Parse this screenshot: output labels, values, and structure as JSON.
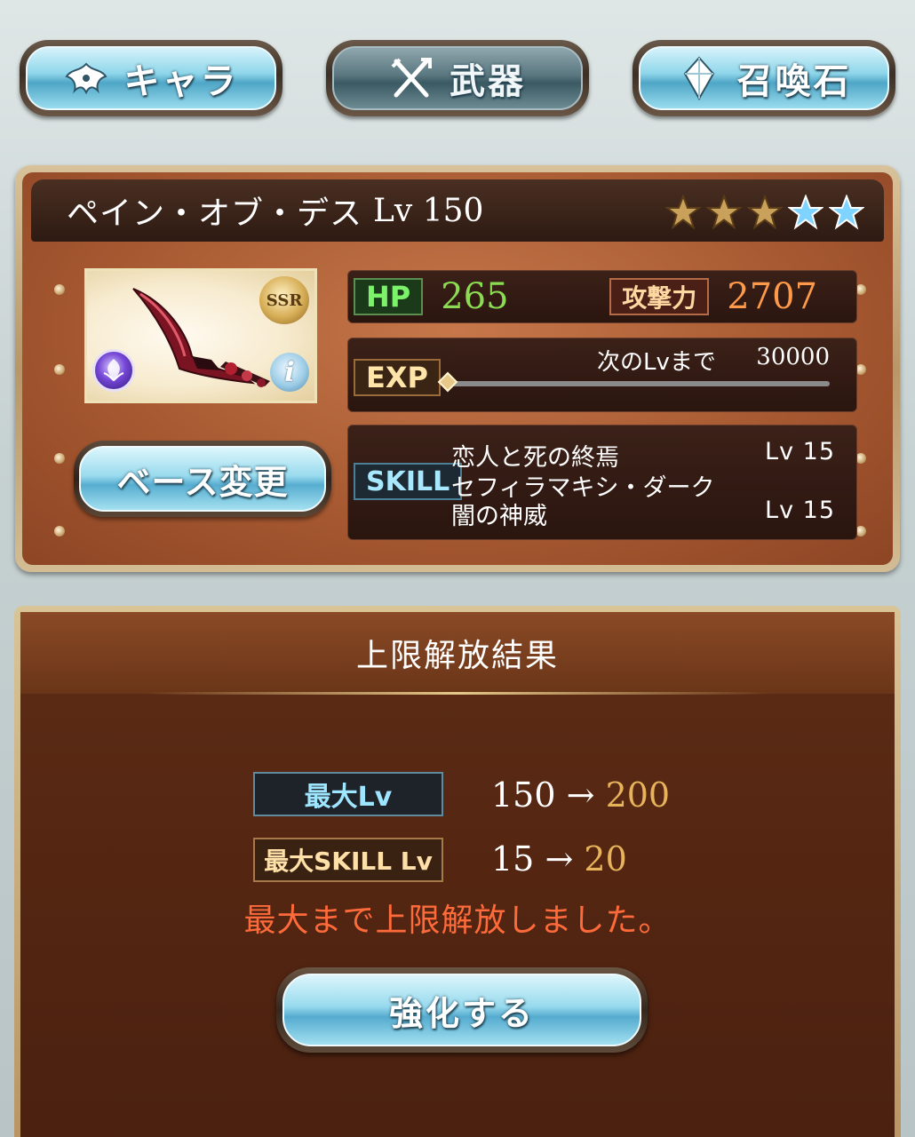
{
  "tabs": [
    {
      "label": "キャラ",
      "icon": "character-emblem-icon",
      "active": false
    },
    {
      "label": "武器",
      "icon": "crossed-weapons-icon",
      "active": true
    },
    {
      "label": "召喚石",
      "icon": "crystal-icon",
      "active": false
    }
  ],
  "weapon": {
    "name": "ペイン・オブ・デス",
    "level": "Lv 150",
    "rarity": "SSR",
    "stars_total": 5,
    "stars_gold": 3,
    "element_icon": "dark-element-icon",
    "info_label": "i",
    "hp_label": "HP",
    "hp": "265",
    "atk_label": "攻撃力",
    "atk": "2707",
    "exp_label": "EXP",
    "next_label": "次のLvまで",
    "next_value": "30000",
    "exp_progress": 0,
    "skill_label": "SKILL",
    "skills": [
      {
        "name": "恋人と死の終焉",
        "level": "Lv 15"
      },
      {
        "name": "セフィラマキシ・ダーク",
        "level": ""
      },
      {
        "name": "闇の神威",
        "level": "Lv 15"
      }
    ],
    "base_change_label": "ベース変更"
  },
  "result": {
    "title": "上限解放結果",
    "max_lv_label": "最大Lv",
    "max_lv_from": "150",
    "max_lv_to": "200",
    "max_skill_label": "最大SKILL Lv",
    "max_skill_from": "15",
    "max_skill_to": "20",
    "arrow": "→",
    "message": "最大まで上限解放しました。",
    "enhance_label": "強化する"
  },
  "colors": {
    "star_gold": "#c9a15a",
    "star_blue": "#7fd3ff",
    "message": "#ff6a3a",
    "new_value": "#e7b45c"
  }
}
